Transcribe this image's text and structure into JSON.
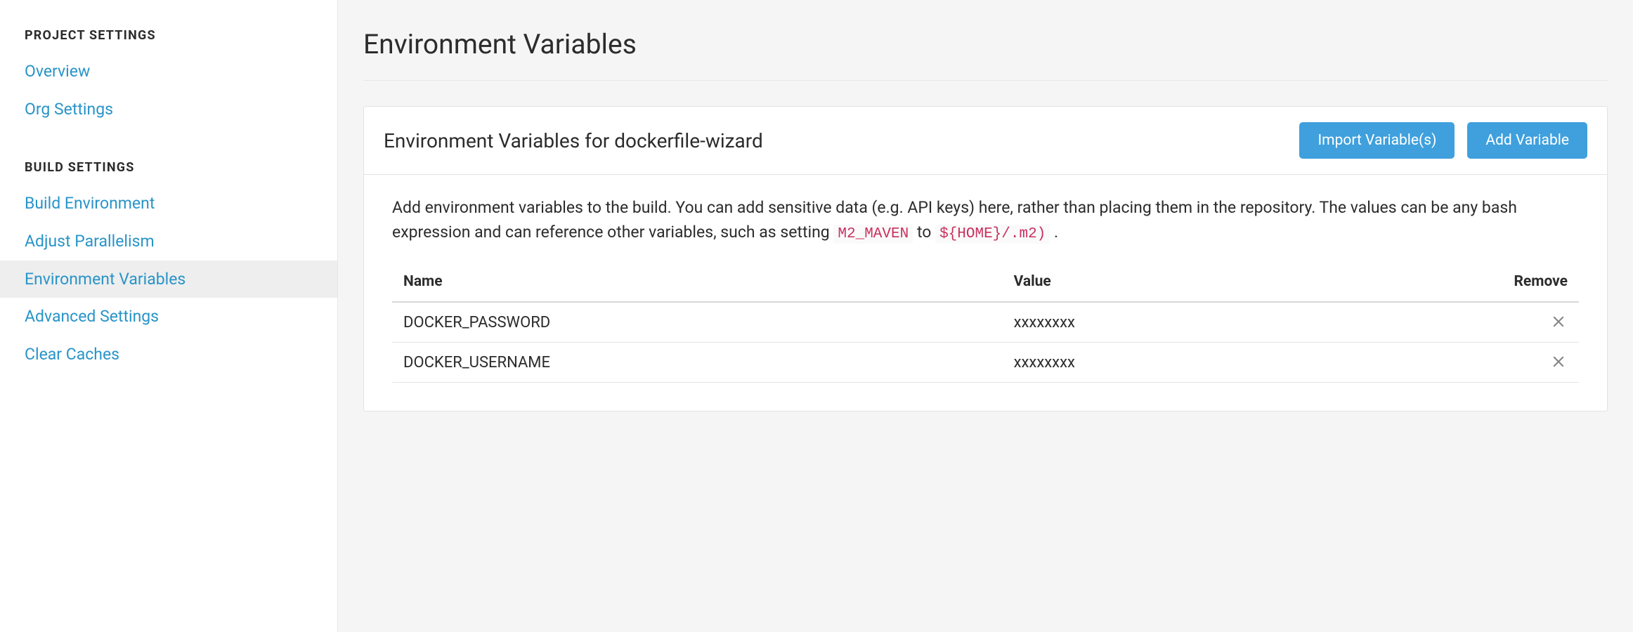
{
  "sidebar": {
    "sections": [
      {
        "heading": "PROJECT SETTINGS",
        "items": [
          {
            "label": "Overview",
            "active": false
          },
          {
            "label": "Org Settings",
            "active": false
          }
        ]
      },
      {
        "heading": "BUILD SETTINGS",
        "items": [
          {
            "label": "Build Environment",
            "active": false
          },
          {
            "label": "Adjust Parallelism",
            "active": false
          },
          {
            "label": "Environment Variables",
            "active": true
          },
          {
            "label": "Advanced Settings",
            "active": false
          },
          {
            "label": "Clear Caches",
            "active": false
          }
        ]
      }
    ]
  },
  "main": {
    "page_title": "Environment Variables",
    "card_title": "Environment Variables for dockerfile-wizard",
    "buttons": {
      "import_label": "Import Variable(s)",
      "add_label": "Add Variable"
    },
    "description": {
      "part1": "Add environment variables to the build. You can add sensitive data (e.g. API keys) here, rather than placing them in the repository. The values can be any bash expression and can reference other variables, such as setting ",
      "code1": "M2_MAVEN",
      "part2": " to ",
      "code2": "${HOME}/.m2)",
      "part3": " ."
    },
    "table": {
      "columns": {
        "name": "Name",
        "value": "Value",
        "remove": "Remove"
      },
      "rows": [
        {
          "name": "DOCKER_PASSWORD",
          "value": "xxxxxxxx"
        },
        {
          "name": "DOCKER_USERNAME",
          "value": "xxxxxxxx"
        }
      ]
    }
  }
}
